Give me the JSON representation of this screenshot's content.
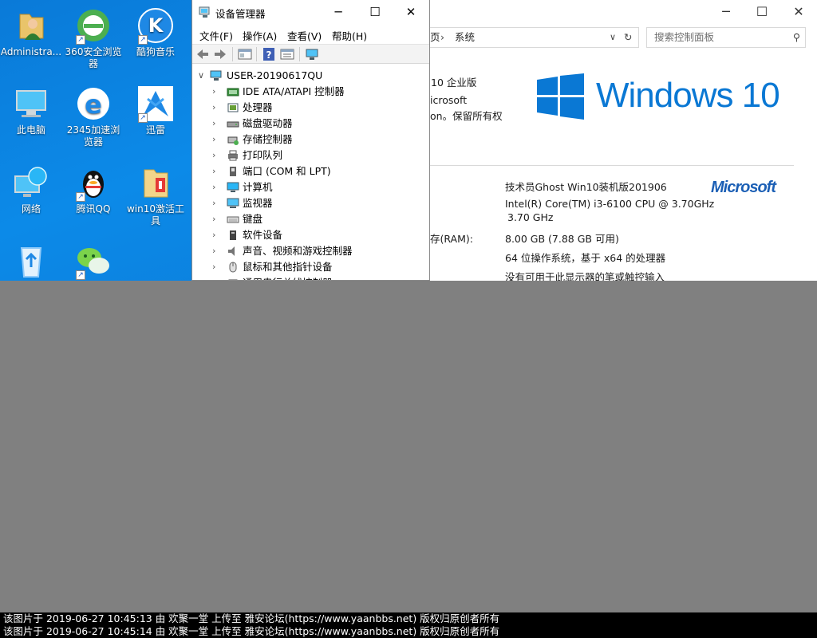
{
  "desktop": {
    "icons": [
      {
        "label": "Administra...",
        "icon": "user-folder-icon"
      },
      {
        "label": "360安全浏览器",
        "icon": "360-browser-icon"
      },
      {
        "label": "酷狗音乐",
        "icon": "kugou-music-icon"
      },
      {
        "label": "此电脑",
        "icon": "this-pc-icon"
      },
      {
        "label": "2345加速浏览器",
        "icon": "2345-browser-icon"
      },
      {
        "label": "迅雷",
        "icon": "xunlei-icon"
      },
      {
        "label": "网络",
        "icon": "network-icon"
      },
      {
        "label": "腾讯QQ",
        "icon": "qq-icon"
      },
      {
        "label": "win10激活工具",
        "icon": "activation-tool-icon"
      },
      {
        "label": "",
        "icon": "recycle-bin-icon"
      },
      {
        "label": "",
        "icon": "wechat-icon"
      }
    ]
  },
  "device_manager": {
    "title": "设备管理器",
    "menus": [
      "文件(F)",
      "操作(A)",
      "查看(V)",
      "帮助(H)"
    ],
    "root": "USER-20190617QU",
    "items": [
      {
        "label": "IDE ATA/ATAPI 控制器",
        "icon": "ide-controller-icon"
      },
      {
        "label": "处理器",
        "icon": "processor-icon"
      },
      {
        "label": "磁盘驱动器",
        "icon": "disk-drive-icon"
      },
      {
        "label": "存储控制器",
        "icon": "storage-controller-icon"
      },
      {
        "label": "打印队列",
        "icon": "print-queue-icon"
      },
      {
        "label": "端口 (COM 和 LPT)",
        "icon": "port-icon"
      },
      {
        "label": "计算机",
        "icon": "computer-icon"
      },
      {
        "label": "监视器",
        "icon": "monitor-icon"
      },
      {
        "label": "键盘",
        "icon": "keyboard-icon"
      },
      {
        "label": "软件设备",
        "icon": "software-device-icon"
      },
      {
        "label": "声音、视频和游戏控制器",
        "icon": "sound-icon"
      },
      {
        "label": "鼠标和其他指针设备",
        "icon": "mouse-icon"
      },
      {
        "label": "通用串行总线控制器",
        "icon": "usb-icon"
      }
    ]
  },
  "system_window": {
    "breadcrumb": "页",
    "breadcrumb_current": "系统",
    "search_placeholder": "搜索控制面板",
    "edition": "10 企业版",
    "copyright_1": "icrosoft",
    "copyright_2": "on。保留所有权",
    "windows_logo_text": "Windows 10",
    "microsoft_logo_text": "Microsoft",
    "label_ram": "存(RAM):",
    "manufacturer_value": "技术员Ghost Win10装机版201906",
    "processor_value_1": "Intel(R) Core(TM) i3-6100 CPU @ 3.70GHz",
    "processor_value_2": "3.70 GHz",
    "ram_value": "8.00 GB (7.88 GB 可用)",
    "system_type_value": "64 位操作系统，基于 x64 的处理器",
    "pen_touch_value": "没有可用于此显示器的笔或触控输入"
  },
  "footer": {
    "line1": "该图片于 2019-06-27 10:45:13 由 欢聚一堂 上传至 雅安论坛(https://www.yaanbbs.net) 版权归原创者所有",
    "line2": "该图片于 2019-06-27 10:45:14 由 欢聚一堂 上传至 雅安论坛(https://www.yaanbbs.net) 版权归原创者所有"
  },
  "colors": {
    "desktop_bg": "#0a7ad8",
    "windows_blue": "#0a78d4",
    "microsoft_blue": "#1b5fb5"
  }
}
